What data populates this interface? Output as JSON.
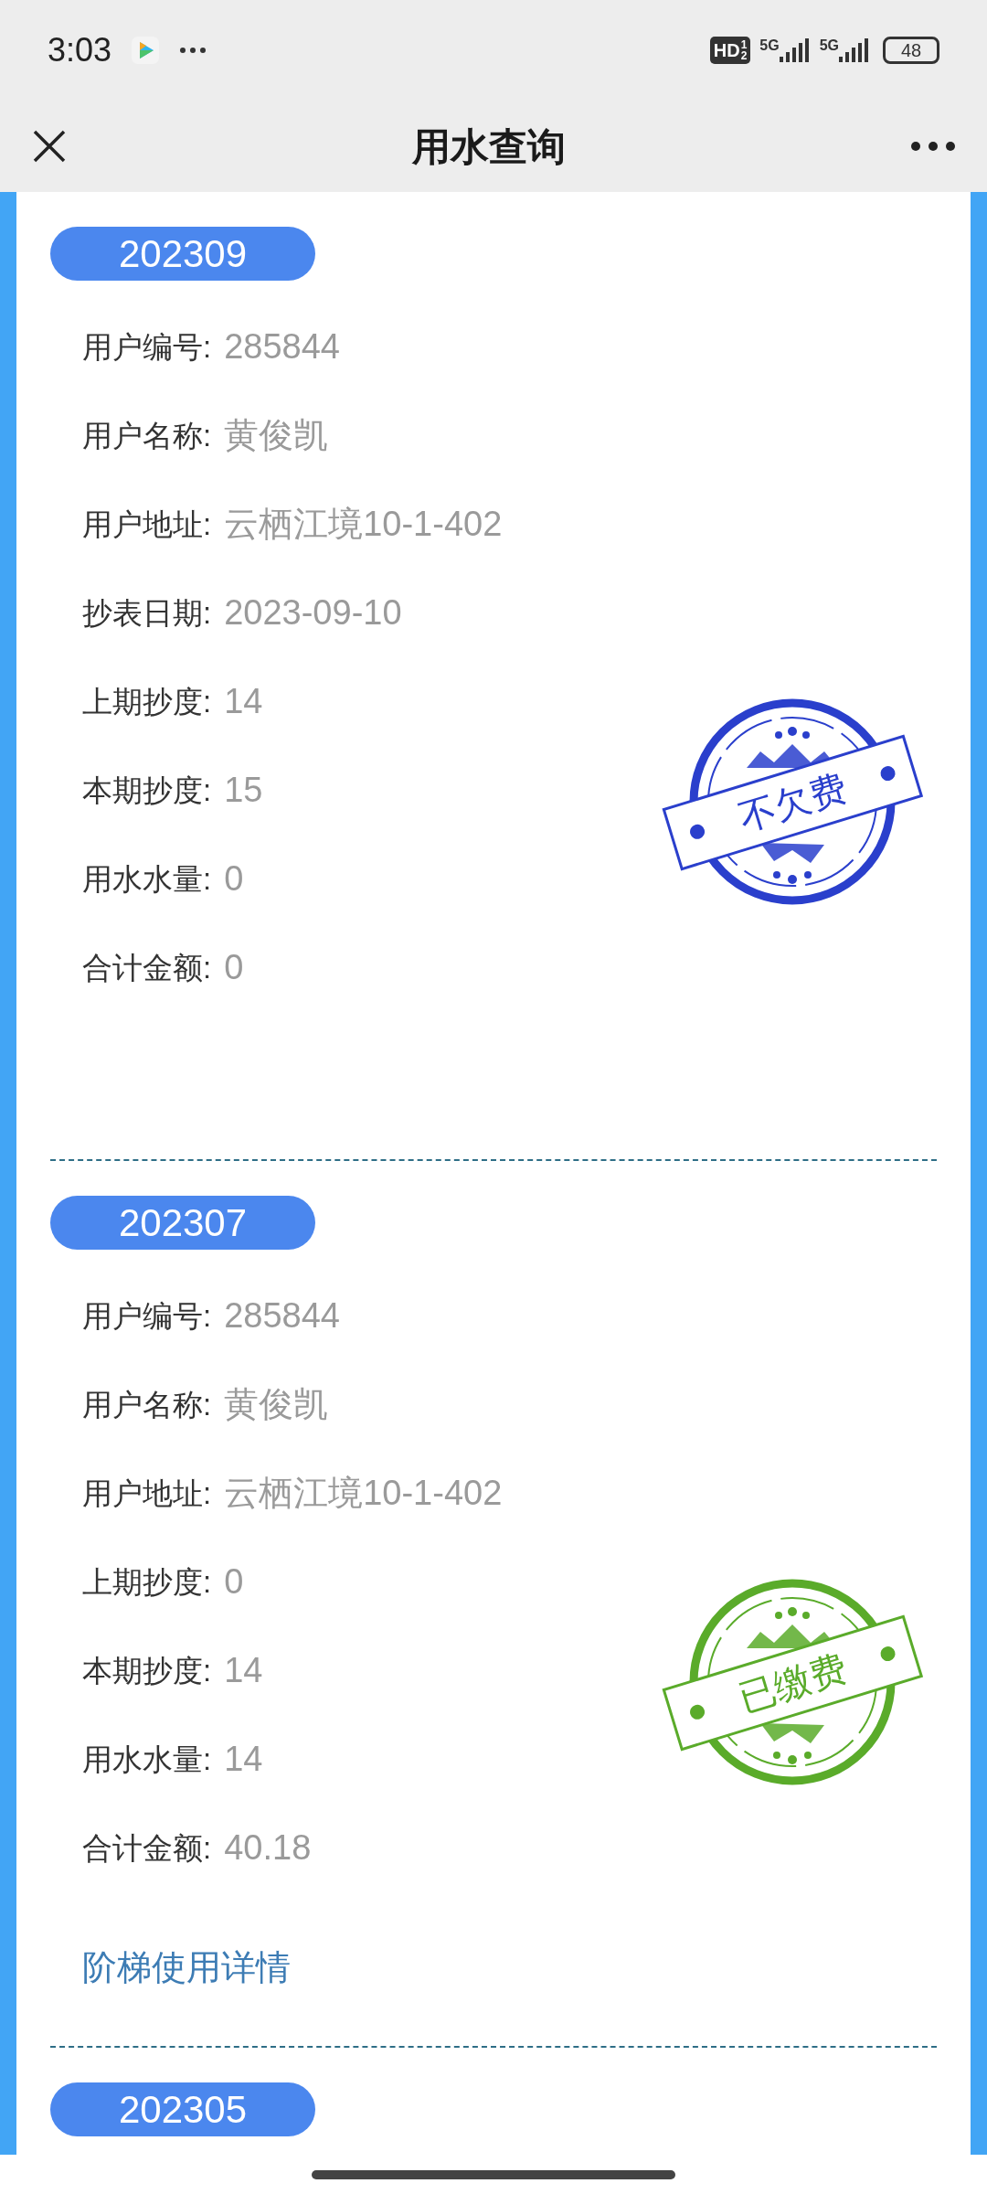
{
  "status_bar": {
    "time": "3:03",
    "hd": "HD",
    "hd_sup": "1",
    "hd_sub": "2",
    "network_1": "5G",
    "network_2": "5G",
    "battery": "48"
  },
  "nav": {
    "title": "用水查询"
  },
  "records": [
    {
      "period": "202309",
      "fields": [
        {
          "label": "用户编号:",
          "value": "285844"
        },
        {
          "label": "用户名称:",
          "value": "黄俊凯"
        },
        {
          "label": "用户地址:",
          "value": "云栖江境10-1-402"
        },
        {
          "label": "抄表日期:",
          "value": "2023-09-10"
        },
        {
          "label": "上期抄度:",
          "value": "14"
        },
        {
          "label": "本期抄度:",
          "value": "15"
        },
        {
          "label": "用水水量:",
          "value": "0"
        },
        {
          "label": "合计金额:",
          "value": "0"
        }
      ],
      "stamp": {
        "text": "不欠费",
        "color": "#2a3fcc"
      }
    },
    {
      "period": "202307",
      "fields": [
        {
          "label": "用户编号:",
          "value": "285844"
        },
        {
          "label": "用户名称:",
          "value": "黄俊凯"
        },
        {
          "label": "用户地址:",
          "value": "云栖江境10-1-402"
        },
        {
          "label": "上期抄度:",
          "value": "0"
        },
        {
          "label": "本期抄度:",
          "value": "14"
        },
        {
          "label": "用水水量:",
          "value": "14"
        },
        {
          "label": "合计金额:",
          "value": "40.18"
        }
      ],
      "stamp": {
        "text": "已缴费",
        "color": "#5aab2a"
      },
      "link": "阶梯使用详情"
    },
    {
      "period": "202305"
    }
  ]
}
